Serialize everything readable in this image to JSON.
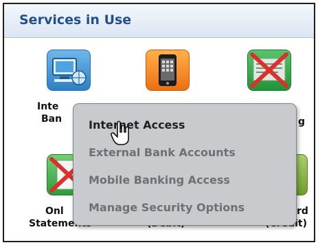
{
  "panel": {
    "title": "Services in Use"
  },
  "tiles": [
    {
      "label_line1": "Inte",
      "label_line2": "Ban",
      "icon": "internet-banking-icon"
    },
    {
      "label_line1": "",
      "label_line2": "",
      "icon": "mobile-phone-icon"
    },
    {
      "label_line1": "",
      "label_line2": "g",
      "icon": "external-banking-disabled-icon"
    },
    {
      "label_line1": "Onl",
      "label_line2": "Statements",
      "icon": "online-statements-disabled-icon"
    },
    {
      "label_line1": "",
      "label_line2": "(Debit)",
      "icon": "card-icon-hidden"
    },
    {
      "label_line1": "rd",
      "label_line2": "(Credit)",
      "icon": "credit-card-icon"
    }
  ],
  "context_menu": {
    "items": [
      {
        "label": "Internet Access",
        "active": true
      },
      {
        "label": "External Bank Accounts",
        "active": false
      },
      {
        "label": "Mobile Banking Access",
        "active": false
      },
      {
        "label": "Manage Security Options",
        "active": false
      }
    ]
  },
  "colors": {
    "title": "#234f8c",
    "menu_bg": "#c8cacd",
    "menu_text_active": "#202124",
    "menu_text_inactive": "#6d7074"
  }
}
